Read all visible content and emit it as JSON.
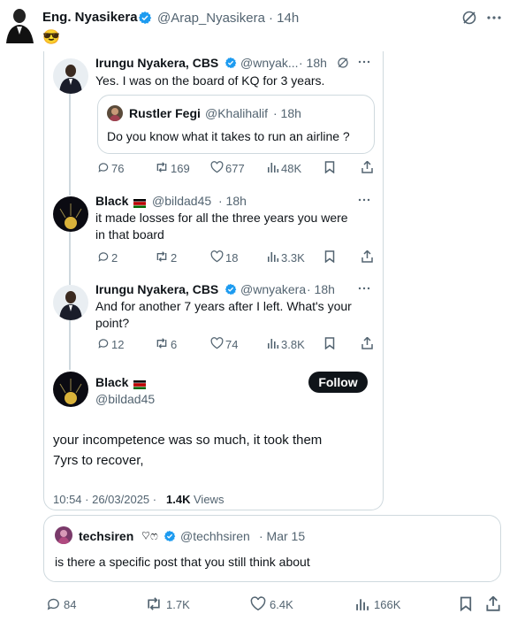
{
  "main_post": {
    "author_name": "Eng. Nyasikera",
    "handle": "@Arap_Nyasikera",
    "time": "· 14h",
    "text": "😎"
  },
  "quoted_thread": {
    "tweet1": {
      "author_name": "Irungu Nyakera, CBS",
      "handle": "@wnyak...",
      "time": "· 18h",
      "text": "Yes. I was on the board of KQ for 3 years.",
      "nested_quote": {
        "author_name": "Rustler Fegi",
        "handle": "@Khalihalif",
        "time": "· 18h",
        "text": "Do you know what it takes to run an airline ?"
      },
      "stats": {
        "replies": "76",
        "reposts": "169",
        "likes": "677",
        "views": "48K"
      }
    },
    "tweet2": {
      "author_name": "Black",
      "handle": "@bildad45",
      "time": "· 18h",
      "text_line1": "it made losses for all the three years you were",
      "text_line2": "in that board",
      "stats": {
        "replies": "2",
        "reposts": "2",
        "likes": "18",
        "views": "3.3K"
      }
    },
    "tweet3": {
      "author_name": "Irungu Nyakera, CBS",
      "handle": "@wnyakera",
      "time": "· 18h",
      "text_line1": "And for another 7 years after I left. What's your",
      "text_line2": "point?",
      "stats": {
        "replies": "12",
        "reposts": "6",
        "likes": "74",
        "views": "3.8K"
      }
    },
    "tweet4": {
      "author_name": "Black",
      "handle": "@bildad45",
      "follow_label": "Follow",
      "text_line1": "your incompetence was so much, it took them",
      "text_line2": "7yrs to recover,",
      "timestamp": "10:54 · 26/03/2025 ·",
      "views_count": "1.4K",
      "views_label": "Views"
    }
  },
  "bottom_quote": {
    "author_name": "techsiren",
    "emoji": "♡ෆ",
    "handle": "@techhsiren",
    "time": "· Mar 15",
    "text": "is there a specific post that you still think about"
  },
  "main_stats": {
    "replies": "84",
    "reposts": "1.7K",
    "likes": "6.4K",
    "views": "166K"
  },
  "colors": {
    "muted": "#536471",
    "verified": "#1d9bf0",
    "border": "#cfd9de",
    "text": "#0f1419"
  }
}
